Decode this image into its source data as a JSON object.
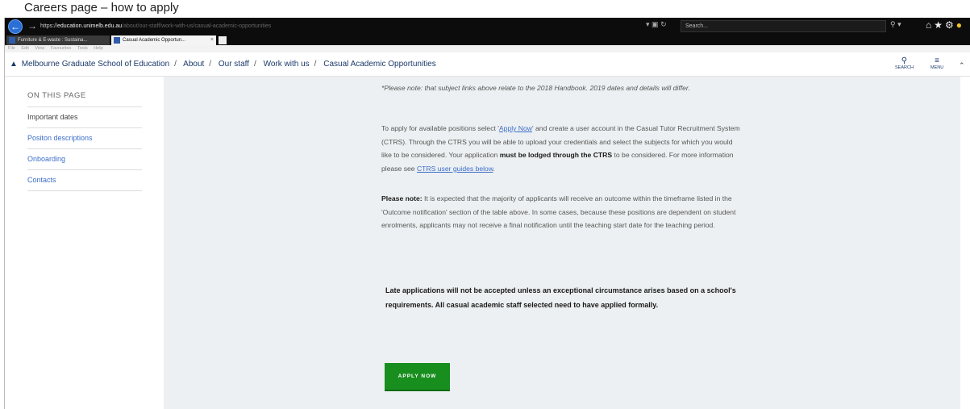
{
  "caption": "Careers page – how to apply",
  "browser": {
    "url_protocol": "https://",
    "url_host": "education.unimelb.edu.au",
    "url_path": "/about/our-staff/work-with-us/casual-academic-opportunities",
    "search_placeholder": "Search...",
    "tabs": [
      {
        "label": "Furniture & E-waste : Sustaina..."
      },
      {
        "label": "Casual Academic Opportun..."
      }
    ],
    "menu": [
      "File",
      "Edit",
      "View",
      "Favourites",
      "Tools",
      "Help"
    ],
    "menu_text": "File Edit View Favourites Tools Help"
  },
  "header": {
    "breadcrumbs": [
      "Melbourne Graduate School of Education",
      "About",
      "Our staff",
      "Work with us",
      "Casual Academic Opportunities"
    ],
    "search_label": "SEARCH",
    "menu_label": "MENU"
  },
  "sidebar": {
    "heading": "ON THIS PAGE",
    "items": [
      {
        "label": "Important dates"
      },
      {
        "label": "Positon descriptions"
      },
      {
        "label": "Onboarding"
      },
      {
        "label": "Contacts"
      }
    ]
  },
  "main": {
    "note_handbook": "*Please note: that subject links above relate to the 2018 Handbook. 2019 dates and details will differ.",
    "apply_intro_1": "To apply for available positions select '",
    "apply_link": "Apply Now",
    "apply_intro_2": "' and create a user account in the Casual Tutor Recruitment System (CTRS). Through the CTRS you will be able to upload your credentials and select the subjects for which you would like to be considered. Your application ",
    "apply_bold": "must be lodged through the CTRS",
    "apply_intro_3": " to be considered. For more information please see ",
    "ctrs_link": "CTRS user guides below",
    "apply_intro_4": ".",
    "please_note_label": "Please note:",
    "please_note_text": " It is expected that the majority of applicants will receive an outcome within the timeframe listed in the 'Outcome notification' section of the table above. In some cases, because these positions are dependent on student enrolments, applicants may not receive a final notification until the teaching start date for the teaching period.",
    "late_notice": "Late applications will not be accepted unless an exceptional circumstance arises based on a school's requirements. All casual academic staff selected need to have applied formally.",
    "apply_button": "APPLY NOW"
  },
  "colors": {
    "apply_button": "#188e1f",
    "link": "#3c6ec9",
    "breadcrumb": "#1b3a6b",
    "content_bg": "#edf0f2"
  }
}
